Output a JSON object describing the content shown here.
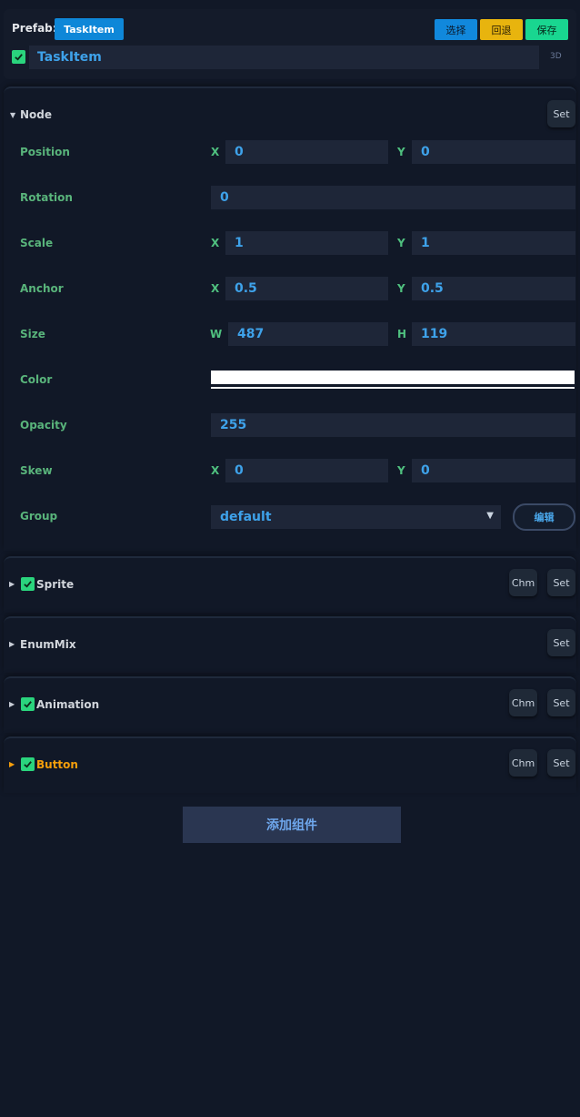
{
  "header": {
    "prefab_label": "Prefab:",
    "prefab_name": "TaskItem",
    "buttons": {
      "select": "选择",
      "revert": "回退",
      "save": "保存"
    },
    "node_name": "TaskItem",
    "node_active": true,
    "mode_tag": "3D"
  },
  "node": {
    "title": "Node",
    "set_label": "Set",
    "position": {
      "label": "Position",
      "x_axis": "X",
      "x": "0",
      "y_axis": "Y",
      "y": "0"
    },
    "rotation": {
      "label": "Rotation",
      "value": "0"
    },
    "scale": {
      "label": "Scale",
      "x_axis": "X",
      "x": "1",
      "y_axis": "Y",
      "y": "1"
    },
    "anchor": {
      "label": "Anchor",
      "x_axis": "X",
      "x": "0.5",
      "y_axis": "Y",
      "y": "0.5"
    },
    "size": {
      "label": "Size",
      "w_axis": "W",
      "w": "487",
      "h_axis": "H",
      "h": "119"
    },
    "color": {
      "label": "Color",
      "value": "#ffffff"
    },
    "opacity": {
      "label": "Opacity",
      "value": "255"
    },
    "skew": {
      "label": "Skew",
      "x_axis": "X",
      "x": "0",
      "y_axis": "Y",
      "y": "0"
    },
    "group": {
      "label": "Group",
      "value": "default",
      "edit_label": "编辑"
    }
  },
  "components": [
    {
      "title": "Sprite",
      "enabled": true,
      "chm": "Chm",
      "set": "Set",
      "color": "#d1d5db"
    },
    {
      "title": "EnumMix",
      "set": "Set",
      "color": "#d1d5db"
    },
    {
      "title": "Animation",
      "enabled": true,
      "chm": "Chm",
      "set": "Set",
      "color": "#d1d5db"
    },
    {
      "title": "Button",
      "enabled": true,
      "chm": "Chm",
      "set": "Set",
      "color": "#f59e0b"
    }
  ],
  "add_component_label": "添加组件",
  "colors": {
    "accent": "#0e87d8",
    "field_text": "#3ea2ea",
    "label": "#59b47b",
    "check": "#2ad47d"
  }
}
